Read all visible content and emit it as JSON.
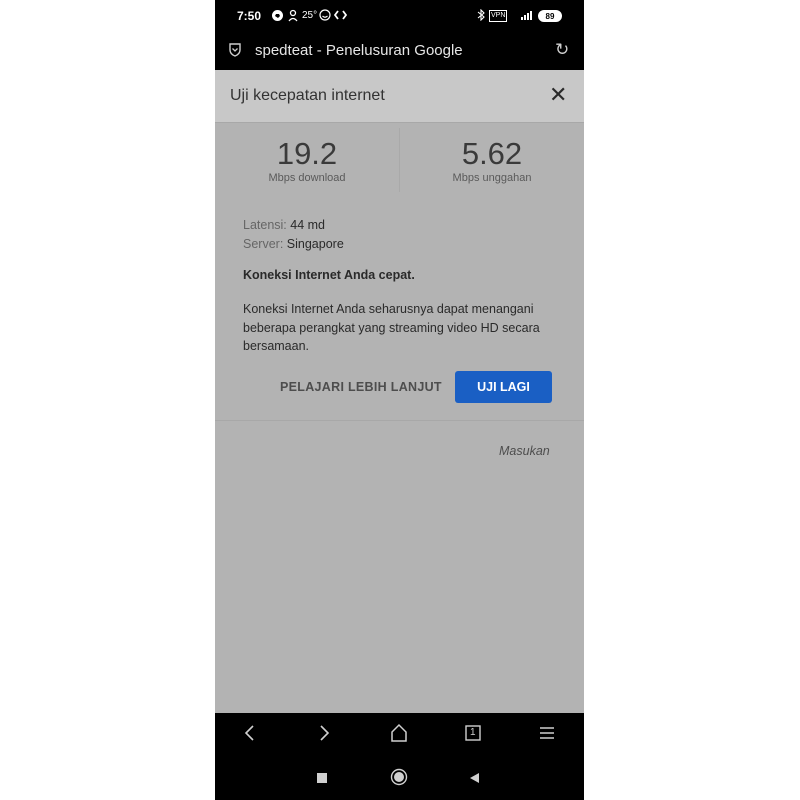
{
  "status_bar": {
    "time": "7:50",
    "temperature": "25°",
    "vpn": "VPN",
    "battery": "89",
    "icons": [
      "whatsapp-icon",
      "user-download-icon",
      "smile-icon",
      "sync-icon",
      "bluetooth-icon",
      "vpn-icon",
      "signal-icon",
      "battery-icon"
    ]
  },
  "browser": {
    "page_title": "spedteat - Penelusuran Google",
    "icons": [
      "shield-icon",
      "reload-icon"
    ]
  },
  "card": {
    "title": "Uji kecepatan internet",
    "download_value": "19.2",
    "download_unit": "Mbps download",
    "upload_value": "5.62",
    "upload_unit": "Mbps unggahan",
    "latency_label": "Latensi:",
    "latency_value": "44 md",
    "server_label": "Server:",
    "server_value": "Singapore",
    "headline": "Koneksi Internet Anda cepat.",
    "description": "Koneksi Internet Anda seharusnya dapat menangani beberapa perangkat yang streaming video HD secara bersamaan.",
    "learn_more": "PELAJARI LEBIH LANJUT",
    "retry": "UJI LAGI",
    "feedback": "Masukan"
  },
  "nav": {
    "icons": [
      "back-icon",
      "forward-icon",
      "home-icon",
      "tabs-icon",
      "menu-icon"
    ],
    "tab_count": "1"
  },
  "system_nav": {
    "icons": [
      "recents-icon",
      "home-circle-icon",
      "back-triangle-icon"
    ]
  },
  "colors": {
    "accent": "#1a5fc4",
    "overlay": "#b3b3b3",
    "bar": "#000000"
  }
}
